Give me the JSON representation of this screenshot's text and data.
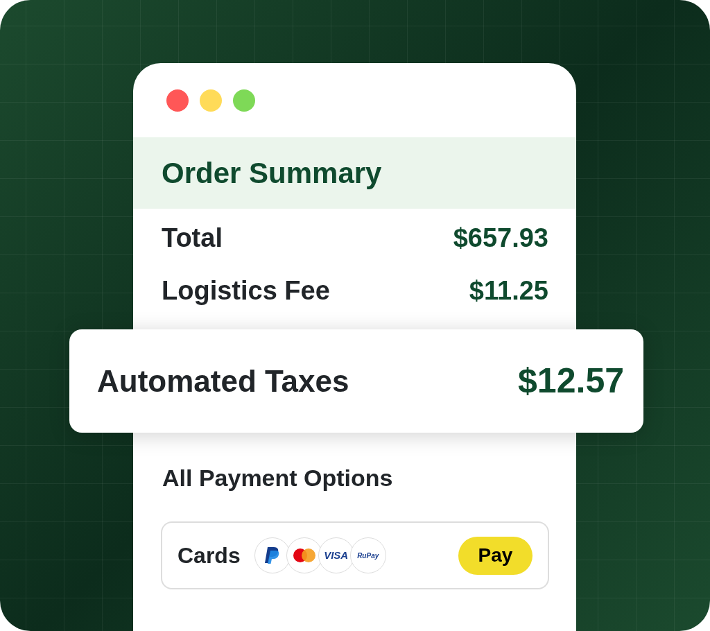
{
  "window": {
    "controls": [
      {
        "color": "#ff5757"
      },
      {
        "color": "#ffdb58"
      },
      {
        "color": "#7ed957"
      }
    ]
  },
  "header": {
    "title": "Order Summary"
  },
  "summary_rows": [
    {
      "label": "Total",
      "amount": "$657.93"
    },
    {
      "label": "Logistics Fee",
      "amount": "$11.25"
    }
  ],
  "highlight": {
    "label": "Automated Taxes",
    "amount": "$12.57"
  },
  "payment": {
    "heading": "All Payment Options",
    "method": "Cards",
    "logos": [
      {
        "kind": "paypal"
      },
      {
        "kind": "mastercard"
      },
      {
        "kind": "visa",
        "text": "VISA"
      },
      {
        "kind": "rupay",
        "text": "RuPay"
      }
    ],
    "button": "Pay"
  }
}
